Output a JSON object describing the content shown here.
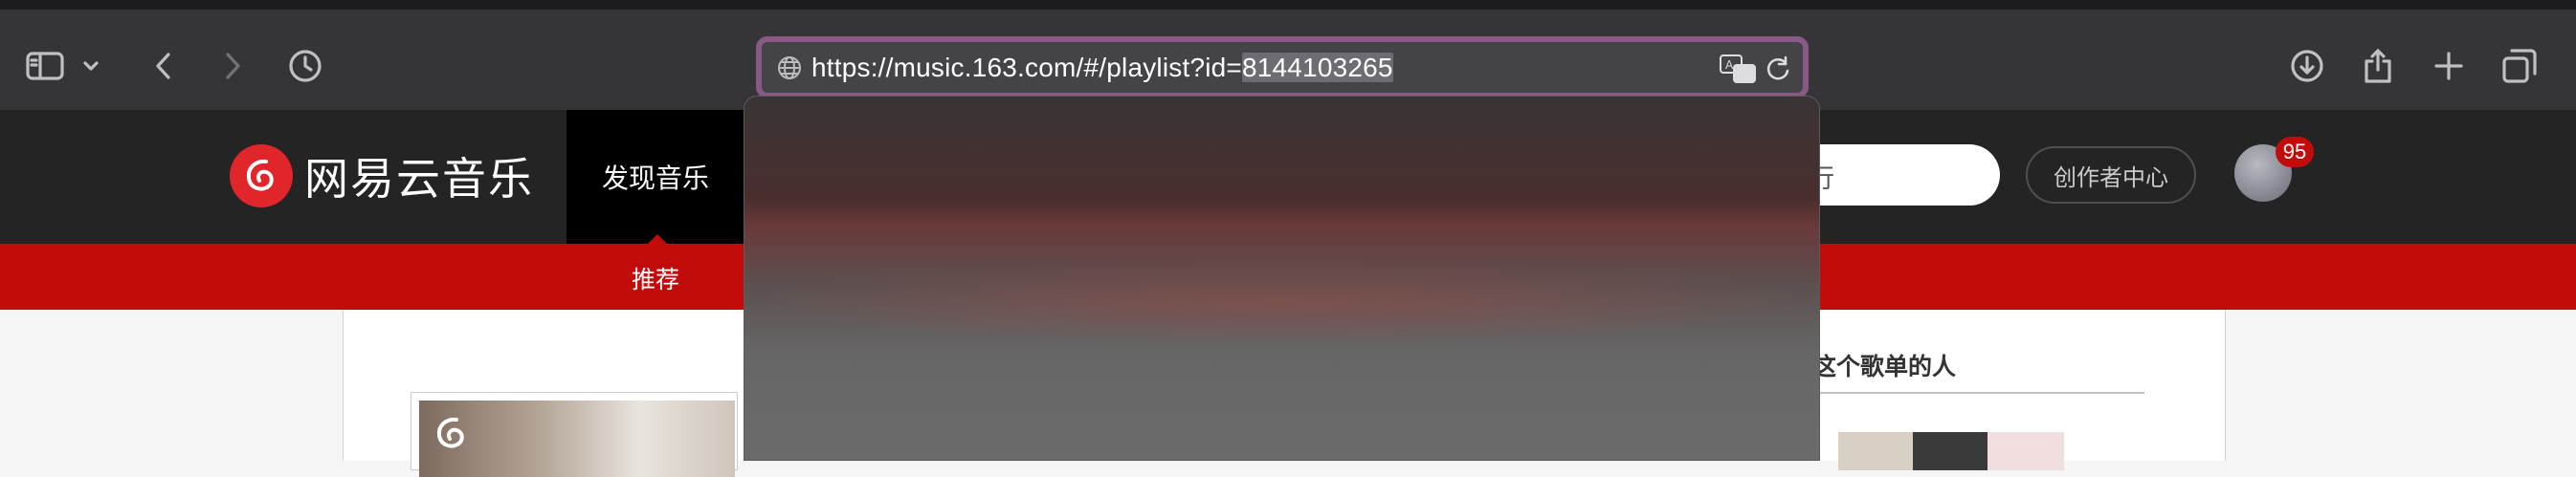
{
  "browser": {
    "url_prefix": "https://music.163.com/#/playlist?id=",
    "url_selected": "8144103265",
    "buttons": [
      "sidebar-toggle",
      "tab-overview",
      "back",
      "forward",
      "history",
      "downloads",
      "share",
      "new-tab",
      "tab-grid"
    ]
  },
  "site": {
    "logo_text": "网易云音乐",
    "nav_active": "发现音乐",
    "search_partial": "行",
    "creator_button": "创作者中心",
    "notification_count": "95",
    "subnav_active": "推荐",
    "side_title": "这个歌单的人",
    "brand_color": "#c20c0c"
  }
}
